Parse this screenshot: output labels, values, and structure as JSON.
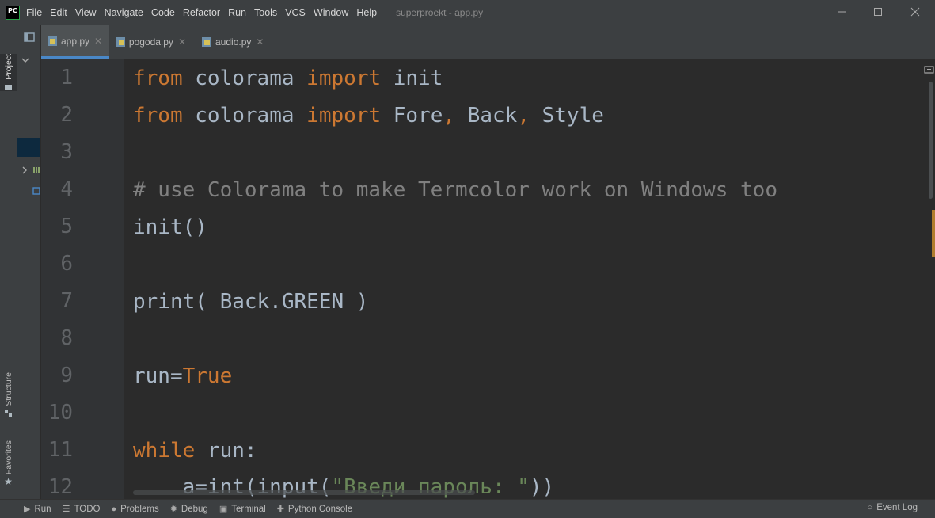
{
  "app": {
    "logo_text": "PC",
    "window_title": "superproekt - app.py"
  },
  "menu": [
    {
      "label": "File"
    },
    {
      "label": "Edit"
    },
    {
      "label": "View"
    },
    {
      "label": "Navigate"
    },
    {
      "label": "Code"
    },
    {
      "label": "Refactor"
    },
    {
      "label": "Run"
    },
    {
      "label": "Tools"
    },
    {
      "label": "VCS"
    },
    {
      "label": "Window"
    },
    {
      "label": "Help"
    }
  ],
  "left_strip": {
    "project": "Project",
    "structure": "Structure",
    "favorites": "Favorites"
  },
  "tabs": [
    {
      "label": "app.py",
      "active": true
    },
    {
      "label": "pogoda.py",
      "active": false
    },
    {
      "label": "audio.py",
      "active": false
    }
  ],
  "line_numbers": [
    "1",
    "2",
    "3",
    "4",
    "5",
    "6",
    "7",
    "8",
    "9",
    "10",
    "11",
    "12"
  ],
  "code": {
    "line1": {
      "kw1": "from",
      "mod": " colorama ",
      "kw2": "import",
      "rest": " init"
    },
    "line2": {
      "kw1": "from",
      "mod": " colorama ",
      "kw2": "import",
      "a": " Fore",
      "c1": ",",
      "b": " Back",
      "c2": ",",
      "c": " Style"
    },
    "line4": {
      "comment": "# use Colorama to make Termcolor work on Windows too"
    },
    "line5": {
      "text": "init()"
    },
    "line7": {
      "text": "print( Back.GREEN )"
    },
    "line9": {
      "lhs": "run=",
      "val": "True"
    },
    "line11": {
      "kw": "while",
      "rest": " run:"
    },
    "line12": {
      "pre": "    a=int(input(",
      "str": "\"Введи пароль: \"",
      "post": "))"
    }
  },
  "bottom_tools": {
    "run": "Run",
    "todo": "TODO",
    "problems": "Problems",
    "debug": "Debug",
    "terminal": "Terminal",
    "python_console": "Python Console",
    "event_log": "Event Log"
  },
  "colors": {
    "keyword": "#cc7832",
    "comment": "#808080",
    "string": "#6a8759",
    "text": "#a9b7c6",
    "active_tab_underline": "#4a88c7"
  }
}
